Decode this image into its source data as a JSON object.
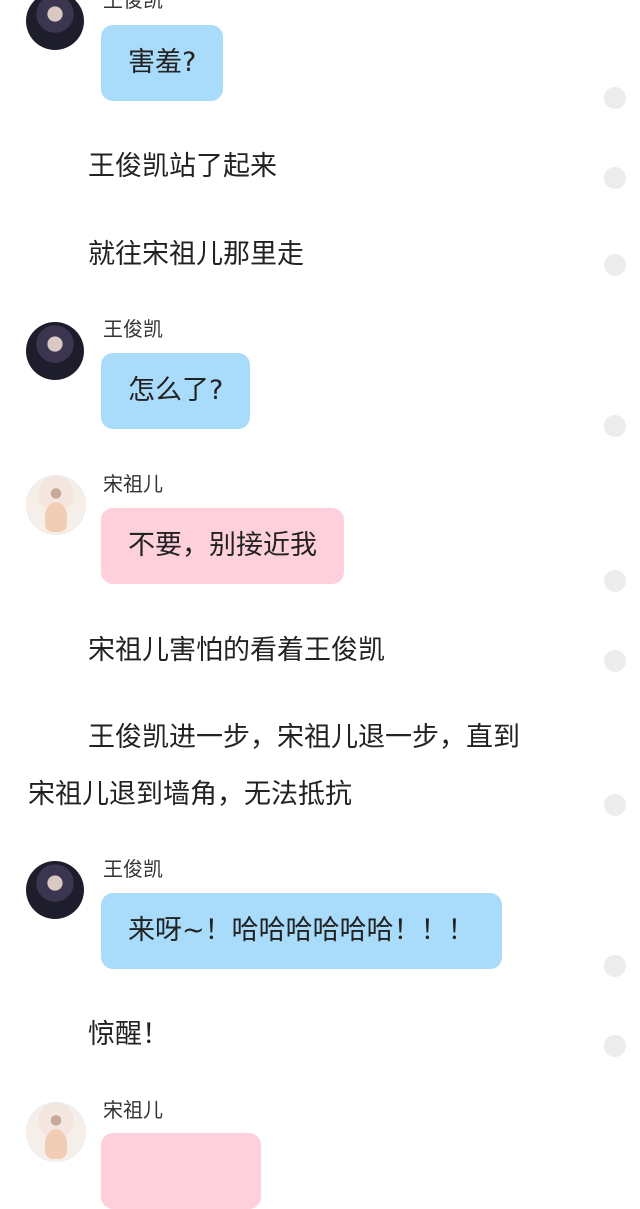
{
  "chat": {
    "msg1": {
      "speaker": "王俊凯",
      "text": "害羞?",
      "style": "blue"
    },
    "narr1": "王俊凯站了起来",
    "narr2": "就往宋祖儿那里走",
    "msg2": {
      "speaker": "王俊凯",
      "text": "怎么了?",
      "style": "blue"
    },
    "msg3": {
      "speaker": "宋祖儿",
      "text": "不要，别接近我",
      "style": "pink"
    },
    "narr3": "宋祖儿害怕的看着王俊凯",
    "narr4_line1": "王俊凯进一步，宋祖儿退一步，直到",
    "narr4_line2": "宋祖儿退到墙角，无法抵抗",
    "msg4": {
      "speaker": "王俊凯",
      "text": "来呀~！哈哈哈哈哈哈！！！",
      "style": "blue"
    },
    "narr5": "惊醒！",
    "msg5": {
      "speaker": "宋祖儿"
    }
  },
  "colors": {
    "blue_bubble": "#a9dcfa",
    "pink_bubble": "#fdd0dc",
    "dot": "#ececec"
  },
  "icons": {
    "boy_avatar": "wang-junkai-avatar",
    "girl_avatar": "song-zuer-avatar",
    "side_dot": "comment-dot-icon"
  }
}
